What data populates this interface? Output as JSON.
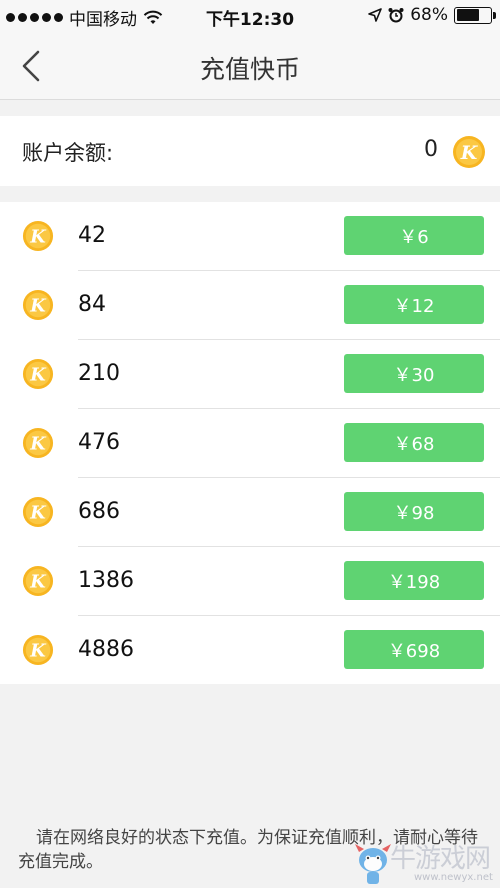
{
  "status_bar": {
    "carrier": "中国移动",
    "time": "下午12:30",
    "battery": "68%",
    "battery_level": 0.68
  },
  "nav": {
    "title": "充值快币"
  },
  "balance": {
    "label": "账户余额:",
    "value": "0"
  },
  "packages": [
    {
      "amount": "42",
      "price": "￥6"
    },
    {
      "amount": "84",
      "price": "￥12"
    },
    {
      "amount": "210",
      "price": "￥30"
    },
    {
      "amount": "476",
      "price": "￥68"
    },
    {
      "amount": "686",
      "price": "￥98"
    },
    {
      "amount": "1386",
      "price": "￥198"
    },
    {
      "amount": "4886",
      "price": "￥698"
    }
  ],
  "footer_note": "请在网络良好的状态下充值。为保证充值顺利，请耐心等待充值完成。",
  "watermark": {
    "text": "牛游戏网",
    "url": "www.newyx.net"
  },
  "colors": {
    "accent_green": "#5fd372",
    "coin_gold": "#f5b324"
  }
}
